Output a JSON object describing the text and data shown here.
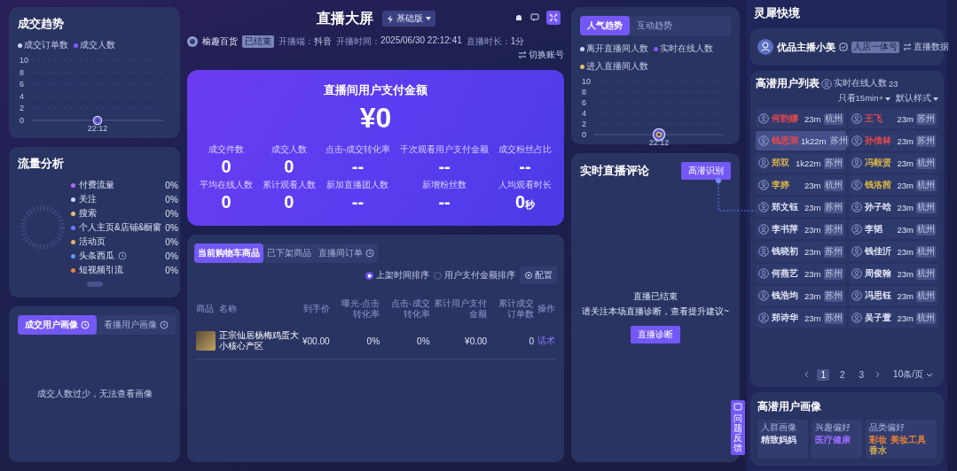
{
  "trade_trend": {
    "title": "成交趋势",
    "chart_data": {
      "type": "line",
      "grid": true,
      "categories": [
        "22:12"
      ],
      "ylim": [
        0,
        10
      ],
      "yticks": [
        0,
        2,
        4,
        6,
        8,
        10
      ],
      "series": [
        {
          "name": "成交订单数",
          "color": "#cfd6ff",
          "marker": true,
          "values": [
            0
          ]
        },
        {
          "name": "成交人数",
          "color": "#7b5cff",
          "marker": true,
          "values": [
            0
          ]
        }
      ]
    }
  },
  "traffic": {
    "title": "流量分析",
    "items": [
      {
        "label": "付费流量",
        "value": "0%",
        "color": "#b06cff"
      },
      {
        "label": "关注",
        "value": "0%",
        "color": "#cfd6ff"
      },
      {
        "label": "搜索",
        "value": "0%",
        "color": "#e3c16a"
      },
      {
        "label": "个人主页&店铺&橱窗",
        "value": "0%",
        "color": "#6c7cff"
      },
      {
        "label": "活动页",
        "value": "0%",
        "color": "#e3b56a"
      },
      {
        "label": "头条西瓜",
        "value": "0%",
        "color": "#5a9cff",
        "info": true
      },
      {
        "label": "短视频引流",
        "value": "0%",
        "color": "#e8823a"
      }
    ]
  },
  "buyer_portrait": {
    "tabs": [
      {
        "label": "成交用户画像",
        "selected": true,
        "info": true
      },
      {
        "label": "看播用户画像",
        "selected": false,
        "info": true
      }
    ],
    "empty": "成交人数过少，无法查看画像"
  },
  "header": {
    "title": "直播大屏",
    "edition": "基础版",
    "account": "榆趣百货",
    "status": "已结束",
    "info": [
      {
        "label": "开播端：",
        "value": "抖音"
      },
      {
        "label": "开播时间：",
        "value": "2025/06/30 22:12:41"
      },
      {
        "label": "直播时长：",
        "value": "1分"
      }
    ],
    "switch": "切换账号"
  },
  "payment": {
    "title": "直播间用户支付金额",
    "amount": "¥0",
    "metrics": [
      {
        "label": "成交件数",
        "value": "0"
      },
      {
        "label": "成交人数",
        "value": "0"
      },
      {
        "label": "点击-成交转化率",
        "value": "--"
      },
      {
        "label": "千次观看用户支付金额",
        "value": "--"
      },
      {
        "label": "成交粉丝占比",
        "value": "--"
      },
      {
        "label": "平均在线人数",
        "value": "0"
      },
      {
        "label": "累计观看人数",
        "value": "0"
      },
      {
        "label": "新加直播团人数",
        "value": "--"
      },
      {
        "label": "新增粉丝数",
        "value": "--"
      },
      {
        "label": "人均观看时长",
        "value": "0",
        "unit": "秒"
      }
    ]
  },
  "products": {
    "tabs": [
      {
        "label": "当前购物车商品",
        "selected": true
      },
      {
        "label": "已下架商品",
        "selected": false
      },
      {
        "label": "直播间订单",
        "selected": false,
        "info": true
      }
    ],
    "sorts": [
      {
        "label": "上架时间排序",
        "selected": true
      },
      {
        "label": "用户支付金额排序",
        "selected": false
      }
    ],
    "config": "配置",
    "columns": [
      "商品",
      "名称",
      "到手价",
      "曝光-点击转化率",
      "点击-成交转化率",
      "累计用户支付金额",
      "累计成交订单数",
      "操作"
    ],
    "rows": [
      {
        "name": "正宗仙居杨梅鸡蛋大小核心产区",
        "price": "¥00.00",
        "ctr": "0%",
        "cvr": "0%",
        "amount": "¥0.00",
        "orders": "0",
        "action": "话术"
      }
    ]
  },
  "popularity": {
    "tabs": [
      {
        "label": "人气趋势",
        "selected": true
      },
      {
        "label": "互动趋势",
        "selected": false
      }
    ],
    "chart_data": {
      "type": "line",
      "grid": true,
      "categories": [
        "22:12"
      ],
      "ylim": [
        0,
        10
      ],
      "yticks": [
        0,
        2,
        4,
        6,
        8,
        10
      ],
      "series": [
        {
          "name": "离开直播间人数",
          "color": "#cfd6ff",
          "marker": true,
          "values": [
            0
          ]
        },
        {
          "name": "实时在线人数",
          "color": "#7b5cff",
          "marker": true,
          "values": [
            0
          ]
        },
        {
          "name": "进入直播间人数",
          "color": "#e3c16a",
          "marker": true,
          "values": [
            0
          ]
        }
      ]
    }
  },
  "comments": {
    "title": "实时直播评论",
    "detect_button": "高潜识别",
    "status": "直播已结束",
    "hint": "请关注本场直播诊断，查看提升建议~",
    "diagnose_button": "直播诊断",
    "feedback": "问题反馈"
  },
  "side": {
    "title": "灵犀快境",
    "anchor": {
      "name": "优品主播小美",
      "badge": "人店一体号",
      "link": "直播数据"
    },
    "users": {
      "title": "高潜用户列表",
      "online_label": "实时在线人数",
      "online_count": "23",
      "filter": "只看15min+",
      "style": "默认样式",
      "items": [
        {
          "name": "何韵娜",
          "time": "23m",
          "city": "杭州",
          "color": "#e5484d",
          "selected": false
        },
        {
          "name": "王飞",
          "time": "23m",
          "city": "苏州",
          "color": "#e5484d",
          "selected": false
        },
        {
          "name": "钱思洞",
          "time": "1k22m",
          "city": "苏州",
          "color": "#e5484d",
          "selected": true
        },
        {
          "name": "孙倩林",
          "time": "23m",
          "city": "苏州",
          "color": "#e5484d",
          "selected": false
        },
        {
          "name": "郑双",
          "time": "1k22m",
          "city": "苏州",
          "color": "#d9b54a",
          "selected": false
        },
        {
          "name": "冯毅贤",
          "time": "23m",
          "city": "杭州",
          "color": "#d9b54a",
          "selected": false
        },
        {
          "name": "李婷",
          "time": "23m",
          "city": "杭州",
          "color": "#d9b54a",
          "selected": false
        },
        {
          "name": "钱洛茜",
          "time": "23m",
          "city": "杭州",
          "color": "#d9b54a",
          "selected": false
        },
        {
          "name": "郑文钰",
          "time": "23m",
          "city": "苏州",
          "color": "#dfe3f5",
          "selected": false
        },
        {
          "name": "孙子晗",
          "time": "23m",
          "city": "杭州",
          "color": "#dfe3f5",
          "selected": false
        },
        {
          "name": "李书萍",
          "time": "23m",
          "city": "苏州",
          "color": "#dfe3f5",
          "selected": false
        },
        {
          "name": "李韬",
          "time": "23m",
          "city": "杭州",
          "color": "#dfe3f5",
          "selected": false
        },
        {
          "name": "钱晓初",
          "time": "23m",
          "city": "苏州",
          "color": "#dfe3f5",
          "selected": false
        },
        {
          "name": "钱佳沂",
          "time": "23m",
          "city": "杭州",
          "color": "#dfe3f5",
          "selected": false
        },
        {
          "name": "何燕艺",
          "time": "23m",
          "city": "苏州",
          "color": "#dfe3f5",
          "selected": false
        },
        {
          "name": "周俊翰",
          "time": "23m",
          "city": "杭州",
          "color": "#dfe3f5",
          "selected": false
        },
        {
          "name": "钱浩均",
          "time": "23m",
          "city": "苏州",
          "color": "#dfe3f5",
          "selected": false
        },
        {
          "name": "冯思钰",
          "time": "23m",
          "city": "杭州",
          "color": "#dfe3f5",
          "selected": false
        },
        {
          "name": "郑诗华",
          "time": "23m",
          "city": "苏州",
          "color": "#dfe3f5",
          "selected": false
        },
        {
          "name": "吴子萱",
          "time": "23m",
          "city": "杭州",
          "color": "#dfe3f5",
          "selected": false
        }
      ],
      "pages": [
        {
          "label": "1",
          "selected": true
        },
        {
          "label": "2",
          "selected": false
        },
        {
          "label": "3",
          "selected": false
        }
      ],
      "page_size": "10条/页"
    },
    "portrait": {
      "title": "高潜用户画像",
      "groups": [
        {
          "label": "人群画像",
          "tags": [
            {
              "text": "精致妈妈",
              "color": "#dfe3f5"
            }
          ]
        },
        {
          "label": "兴趣偏好",
          "tags": [
            {
              "text": "医疗健康",
              "color": "#9b6cff"
            }
          ]
        },
        {
          "label": "品类偏好",
          "tags": [
            {
              "text": "彩妆",
              "color": "#e8823a"
            },
            {
              "text": "美妆工具",
              "color": "#e8823a"
            },
            {
              "text": "香水",
              "color": "#d9b54a"
            }
          ]
        }
      ]
    }
  }
}
